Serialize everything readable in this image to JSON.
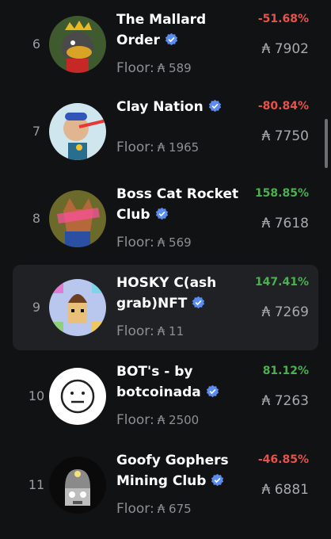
{
  "currency_symbol": "₳",
  "floor_label": "Floor:",
  "rows": [
    {
      "rank": "6",
      "name_line1": "The Mallard",
      "name_line2": "Order",
      "change": "-51.68%",
      "direction": "negative",
      "volume": "₳ 7902",
      "floor": "₳ 589"
    },
    {
      "rank": "7",
      "name_line1": "Clay Nation",
      "name_line2": "",
      "change": "-80.84%",
      "direction": "negative",
      "volume": "₳ 7750",
      "floor": "₳ 1965"
    },
    {
      "rank": "8",
      "name_line1": "Boss Cat Rocket",
      "name_line2": "Club",
      "change": "158.85%",
      "direction": "positive",
      "volume": "₳ 7618",
      "floor": "₳ 569"
    },
    {
      "rank": "9",
      "name_line1": "HOSKY C(ash",
      "name_line2": "grab)NFT",
      "change": "147.41%",
      "direction": "positive",
      "volume": "₳ 7269",
      "floor": "₳ 11"
    },
    {
      "rank": "10",
      "name_line1": "BOT's - by",
      "name_line2": "botcoinada",
      "change": "81.12%",
      "direction": "positive",
      "volume": "₳ 7263",
      "floor": "₳ 2500"
    },
    {
      "rank": "11",
      "name_line1": "Goofy Gophers",
      "name_line2": "Mining Club",
      "change": "-46.85%",
      "direction": "negative",
      "volume": "₳ 6881",
      "floor": "₳ 675"
    }
  ],
  "colors": {
    "background": "#111213",
    "selected_row": "#1f2124",
    "negative": "#e5534b",
    "positive": "#4caf50",
    "verified_badge": "#5b8def"
  },
  "icons": {
    "verified": "verified-badge-icon"
  }
}
